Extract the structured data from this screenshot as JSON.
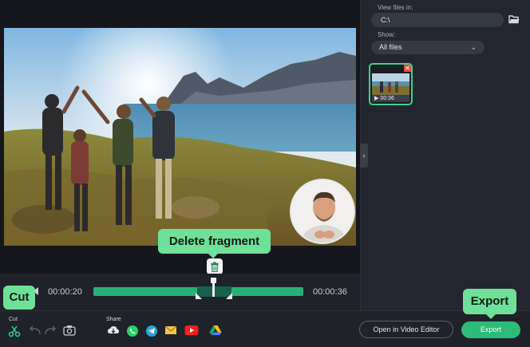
{
  "panel": {
    "view_files_label": "View files in:",
    "path_value": "C:\\",
    "show_label": "Show:",
    "show_value": "All files",
    "thumbnail_duration": "00:36"
  },
  "preview": {
    "delete_tooltip": "Delete fragment"
  },
  "timeline": {
    "start_time": "00:00:20",
    "end_time": "00:00:36"
  },
  "toolbar": {
    "cut_tooltip": "Cut",
    "cut_label": "Cut",
    "share_label": "Share",
    "open_editor_label": "Open in Video Editor",
    "export_label": "Export",
    "export_tooltip": "Export",
    "share_icons": [
      "cloud-icon",
      "whatsapp-icon",
      "telegram-icon",
      "email-icon",
      "youtube-icon",
      "google-drive-icon"
    ]
  },
  "colors": {
    "accent": "#2dbb7a",
    "tooltip": "#6ee09a",
    "track": "#27b178",
    "fragment": "#17614a",
    "panel_bg": "#23262e",
    "thumbnail_close": "#e5484d"
  }
}
